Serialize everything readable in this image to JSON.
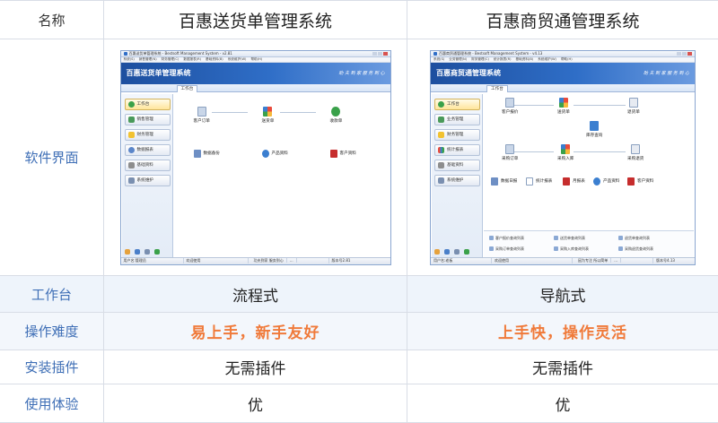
{
  "header": {
    "name_col": "名称",
    "product_a": "百惠送货单管理系统",
    "product_b": "百惠商贸通管理系统"
  },
  "row_labels": {
    "ui": "软件界面",
    "workbench": "工作台",
    "difficulty": "操作难度",
    "plugin": "安装插件",
    "experience": "使用体验"
  },
  "values": {
    "workbench": {
      "a": "流程式",
      "b": "导航式"
    },
    "difficulty": {
      "a": "易上手，新手友好",
      "b": "上手快，操作灵活"
    },
    "plugin": {
      "a": "无需插件",
      "b": "无需插件"
    },
    "experience": {
      "a": "优",
      "b": "优"
    }
  },
  "colors": {
    "label": "#3f6fb6",
    "highlight": "#f07a3a",
    "banner": "#1d4f9f"
  },
  "app_a": {
    "window_title": "百惠送货单管理系统 - Bestsoft Management System - v2.81",
    "menu": [
      "系统(S)",
      "销售管理(N)",
      "财务管理(C)",
      "数据报表(R)",
      "基础资料(B)",
      "系统维护(W)",
      "帮助(H)"
    ],
    "banner_title": "百惠送货单管理系统",
    "slogan": "助 夫 到 家  服 务 到 心",
    "tab": "工作台",
    "sidebar": [
      "工作台",
      "销售管理",
      "财务管理",
      "数据报表",
      "基础资料",
      "系统维护"
    ],
    "flow": [
      "客户订单",
      "送货单",
      "收款单"
    ],
    "bottom": [
      "数据备份",
      "产品资料",
      "客户资料"
    ],
    "status": [
      "用户名:管理员",
      "欢迎使用",
      "功夫到家 服务到心",
      "版本号2.81"
    ],
    "status_suffix": "..."
  },
  "app_b": {
    "window_title": "百惠商贸通管理系统 - Bestsoft Management System - v4.13",
    "menu": [
      "系统(S)",
      "业务管理(N)",
      "财务管理(C)",
      "统计报表(R)",
      "基础资料(B)",
      "系统维护(W)",
      "帮助(H)"
    ],
    "banner_title": "百惠商贸通管理系统",
    "slogan": "助 夫 到 家  服 务 到 心",
    "tab": "工作台",
    "sidebar": [
      "工作台",
      "业务管理",
      "财务管理",
      "统计报表",
      "基础资料",
      "系统维护"
    ],
    "nodes": [
      "客户报价",
      "送货单",
      "退货单",
      "库存查询",
      "采购订单",
      "采购入库",
      "采购退货"
    ],
    "bottom": [
      "数据日报",
      "统计报表",
      "月报表",
      "产品资料",
      "客户资料"
    ],
    "queries": [
      "客户报价查询列表",
      "送货单查询列表",
      "退货单查询列表",
      "采购订单查询列表",
      "采购入库查询列表",
      "采购退货查询列表"
    ],
    "status": [
      "用户名:老板",
      "欢迎使用",
      "因为专注 所以简单",
      "版本号4.13"
    ],
    "status_suffix": "..."
  }
}
